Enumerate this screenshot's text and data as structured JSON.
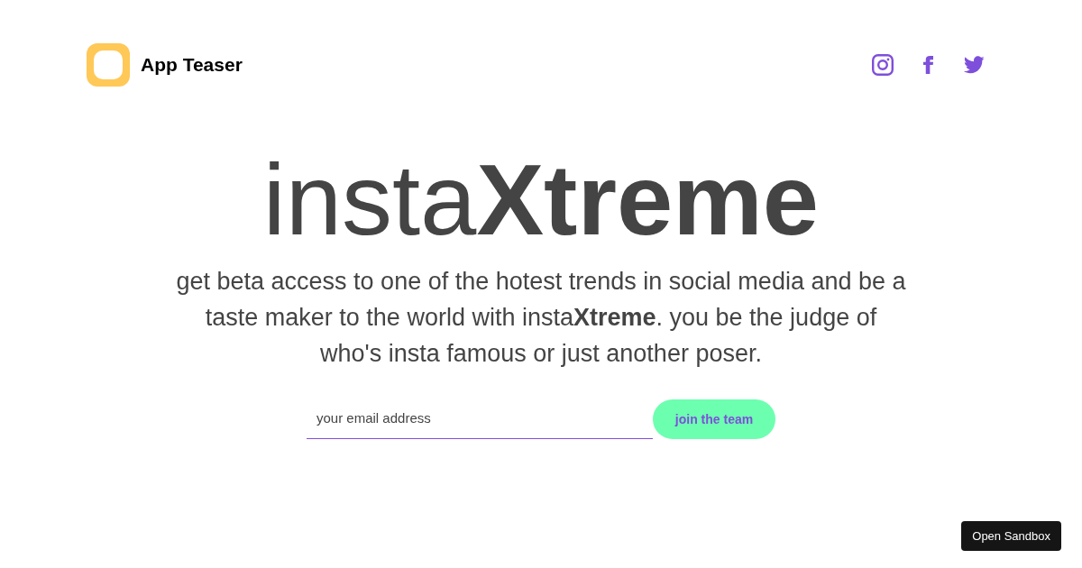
{
  "header": {
    "logo_text": "App Teaser",
    "social_links": [
      {
        "kind": "instagram"
      },
      {
        "kind": "facebook"
      },
      {
        "kind": "twitter"
      }
    ]
  },
  "hero": {
    "title": "insta**Xtreme**",
    "description": "get beta access to one of the hotest trends in social media and be a taste maker to the world with insta**Xtreme**. you be the judge of who's insta famous or just another poser."
  },
  "signup": {
    "email": {
      "placeholder": "your email address"
    },
    "button": "join the team"
  },
  "sandbox_button": "Open Sandbox"
}
